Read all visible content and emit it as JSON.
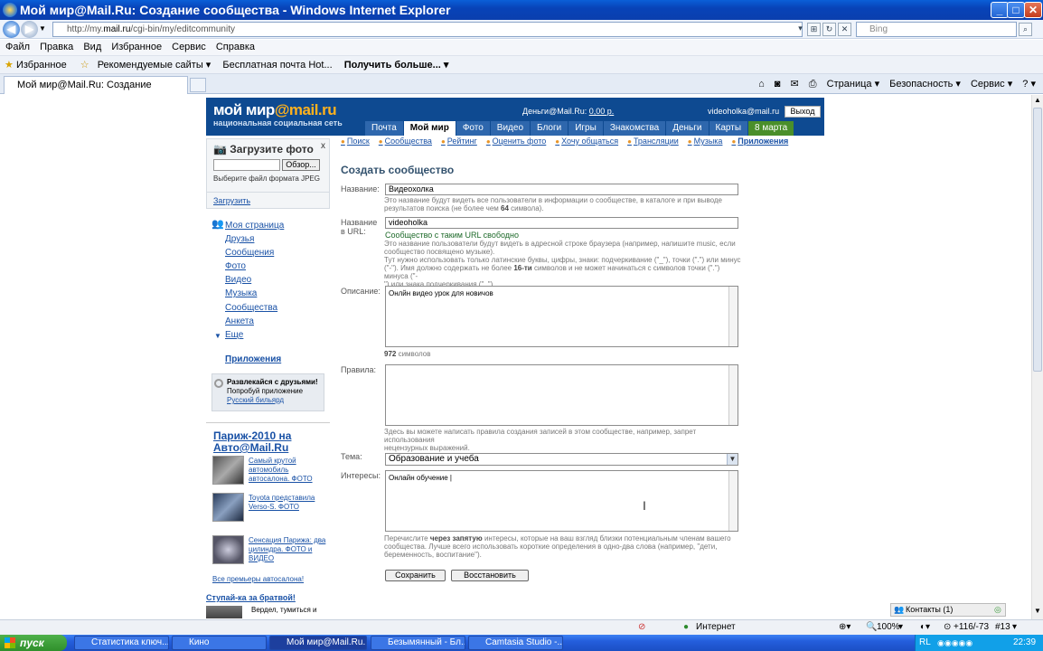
{
  "window": {
    "title": "Мой мир@Mail.Ru: Создание сообщества - Windows Internet Explorer",
    "minimize": "_",
    "maximize": "□",
    "close": "✕"
  },
  "address": {
    "url_prefix": "http://my.",
    "url_domain": "mail.ru",
    "url_path": "/cgi-bin/my/editcommunity",
    "search_placeholder": "Bing"
  },
  "menu": [
    "Файл",
    "Правка",
    "Вид",
    "Избранное",
    "Сервис",
    "Справка"
  ],
  "favorites": {
    "label": "Избранное",
    "items": [
      "Рекомендуемые сайты ▾",
      "Бесплатная почта Hot...",
      "Получить больше... ▾"
    ]
  },
  "tab": {
    "title": "Мой мир@Mail.Ru: Создание сообщества"
  },
  "commands": [
    "Страница ▾",
    "Безопасность ▾",
    "Сервис ▾",
    "? ▾"
  ],
  "site": {
    "logo_main": "мой мир",
    "logo_at": "@mail.ru",
    "logo_sub": "национальная социальная сеть",
    "money_label": "Деньги@Mail.Ru:",
    "money_value": "0,00 р.",
    "email": "videoholka@mail.ru",
    "logout": "Выход",
    "nav": [
      "Почта",
      "Мой мир",
      "Фото",
      "Видео",
      "Блоги",
      "Игры",
      "Знакомства",
      "Деньги",
      "Карты"
    ],
    "date": "8 марта"
  },
  "upload": {
    "title": "Загрузите фото",
    "close": "x",
    "browse": "Обзор...",
    "hint": "Выберите файл формата JPEG",
    "submit": "Загрузить"
  },
  "leftnav": {
    "mypage": "Моя страница",
    "items": [
      "Друзья",
      "Сообщения",
      "Фото",
      "Видео",
      "Музыка",
      "Сообщества",
      "Анкета",
      "Еще"
    ],
    "apps": "Приложения"
  },
  "promo": {
    "line1": "Развлекайся с друзьями!",
    "line2": "Попробуй приложение",
    "link": "Русский бильярд"
  },
  "paris": {
    "title": "Париж-2010 на Авто@Mail.Ru",
    "items": [
      "Самый крутой автомобиль автосалона. ФОТО",
      "Toyota представила Verso-S. ФОТО",
      "Сенсация Парижа: два цилиндра. ФОТО и ВИДЕО"
    ],
    "all": "Все премьеры автосалона!",
    "next": "Ступай-ка за братвой!",
    "next_text": "Вердел, тумиться и"
  },
  "subnav": [
    "Поиск",
    "Сообщества",
    "Рейтинг",
    "Оценить фото",
    "Хочу общаться",
    "Трансляции",
    "Музыка",
    "Приложения"
  ],
  "form": {
    "title": "Создать сообщество",
    "name_label": "Название:",
    "name_value": "Видеохолка",
    "name_hint_1": "Это название будут видеть все пользователи в информации о сообществе, в каталоге и при выводе",
    "name_hint_2a": "результатов поиска (не более чем ",
    "name_hint_2b": "64",
    "name_hint_2c": " символа).",
    "url_label_1": "Название",
    "url_label_2": "в URL:",
    "url_value": "videoholka",
    "url_ok": "Сообщество с таким URL свободно",
    "url_hint_1": "Это название пользователи будут видеть в адресной строке браузера (например, напишите music, если",
    "url_hint_2": "сообщество посвящено музыке).",
    "url_hint_3": "Тут нужно использовать только латинские буквы, цифры, знаки: подчеркивание (\"_\"), точки (\".\") или минус",
    "url_hint_4a": "(\"-\"). Имя должно содержать не более ",
    "url_hint_4b": "16-ти",
    "url_hint_4c": " символов и не может начинаться с символов точки (\".\") минуса (\"-",
    "url_hint_5": "\") или знака подчеркивания (\"_\").",
    "desc_label": "Описание:",
    "desc_value": "Онлйн видео урок для новичов",
    "desc_count": "972",
    "desc_count_label": " символов",
    "rules_label": "Правила:",
    "rules_hint_1": "Здесь вы можете написать правила создания записей в этом сообществе, например, запрет использования",
    "rules_hint_2": "нецензурных выражений.",
    "topic_label": "Тема:",
    "topic_value": "Образование и учеба",
    "interests_label": "Интересы:",
    "interests_value": "Онлайн обучение |",
    "int_hint_1a": "Перечислите ",
    "int_hint_1b": "через запятую",
    "int_hint_1c": " интересы, которые на ваш взгляд близки потенциальным членам вашего",
    "int_hint_2": "сообщества. Лучше всего использовать короткие определения в одно-два слова (например, \"дети,",
    "int_hint_3": "беременность, воспитание\").",
    "save": "Сохранить",
    "restore": "Восстановить"
  },
  "contacts": "Контакты (1)",
  "status": {
    "zone": "Интернет",
    "zoom": "100%",
    "extra": "+116/-73",
    "num": "#13"
  },
  "taskbar": {
    "start": "пуск",
    "tasks": [
      "Статистика ключ...",
      "Кино",
      "Мой мир@Mail.Ru...",
      "Безымянный - Бл...",
      "Camtasia Studio -..."
    ],
    "lang": "RL",
    "time": "22:39"
  }
}
